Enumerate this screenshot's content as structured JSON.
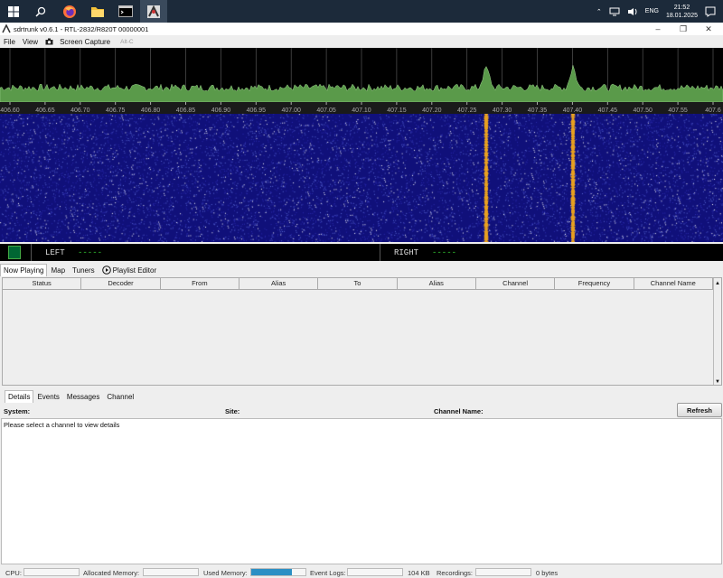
{
  "taskbar": {
    "time": "21:52",
    "date": "18.01.2025",
    "lang": "ENG"
  },
  "window": {
    "title": "sdrtrunk v0.6.1 - RTL-2832/R820T 00000001"
  },
  "menu": {
    "file": "File",
    "view": "View",
    "screen_capture": "Screen Capture",
    "screen_capture_shortcut": "Alt-C"
  },
  "spectrum": {
    "freq_labels": [
      "406.60",
      "406.65",
      "406.70",
      "406.75",
      "406.80",
      "406.85",
      "406.90",
      "406.95",
      "407.00",
      "407.05",
      "407.10",
      "407.15",
      "407.20",
      "407.25",
      "407.30",
      "407.35",
      "407.40",
      "407.45",
      "407.50",
      "407.55",
      "407.6"
    ]
  },
  "audio": {
    "left_label": "LEFT",
    "left_value": "-----",
    "right_label": "RIGHT",
    "right_value": "-----"
  },
  "main_tabs": [
    "Now Playing",
    "Map",
    "Tuners",
    "Playlist Editor"
  ],
  "table": {
    "columns": [
      "Status",
      "Decoder",
      "From",
      "Alias",
      "To",
      "Alias",
      "Channel",
      "Frequency",
      "Channel Name"
    ]
  },
  "detail_tabs": [
    "Details",
    "Events",
    "Messages",
    "Channel"
  ],
  "detail": {
    "system": "System:",
    "site": "Site:",
    "channel_name": "Channel Name:",
    "refresh": "Refresh",
    "placeholder": "Please select a channel to view details"
  },
  "status_bar": {
    "cpu": "CPU:",
    "allocated": "Allocated Memory:",
    "used": "Used Memory:",
    "used_fraction": 0.75,
    "event_logs": "Event Logs:",
    "event_logs_size": "104 KB",
    "recordings": "Recordings:",
    "recordings_size": "0 bytes"
  },
  "colors": {
    "signal": "#e8a020",
    "waterfall": "#10107a",
    "spectrum_fill": "#5a9a4a",
    "used_bar": "#2b8fc4"
  }
}
